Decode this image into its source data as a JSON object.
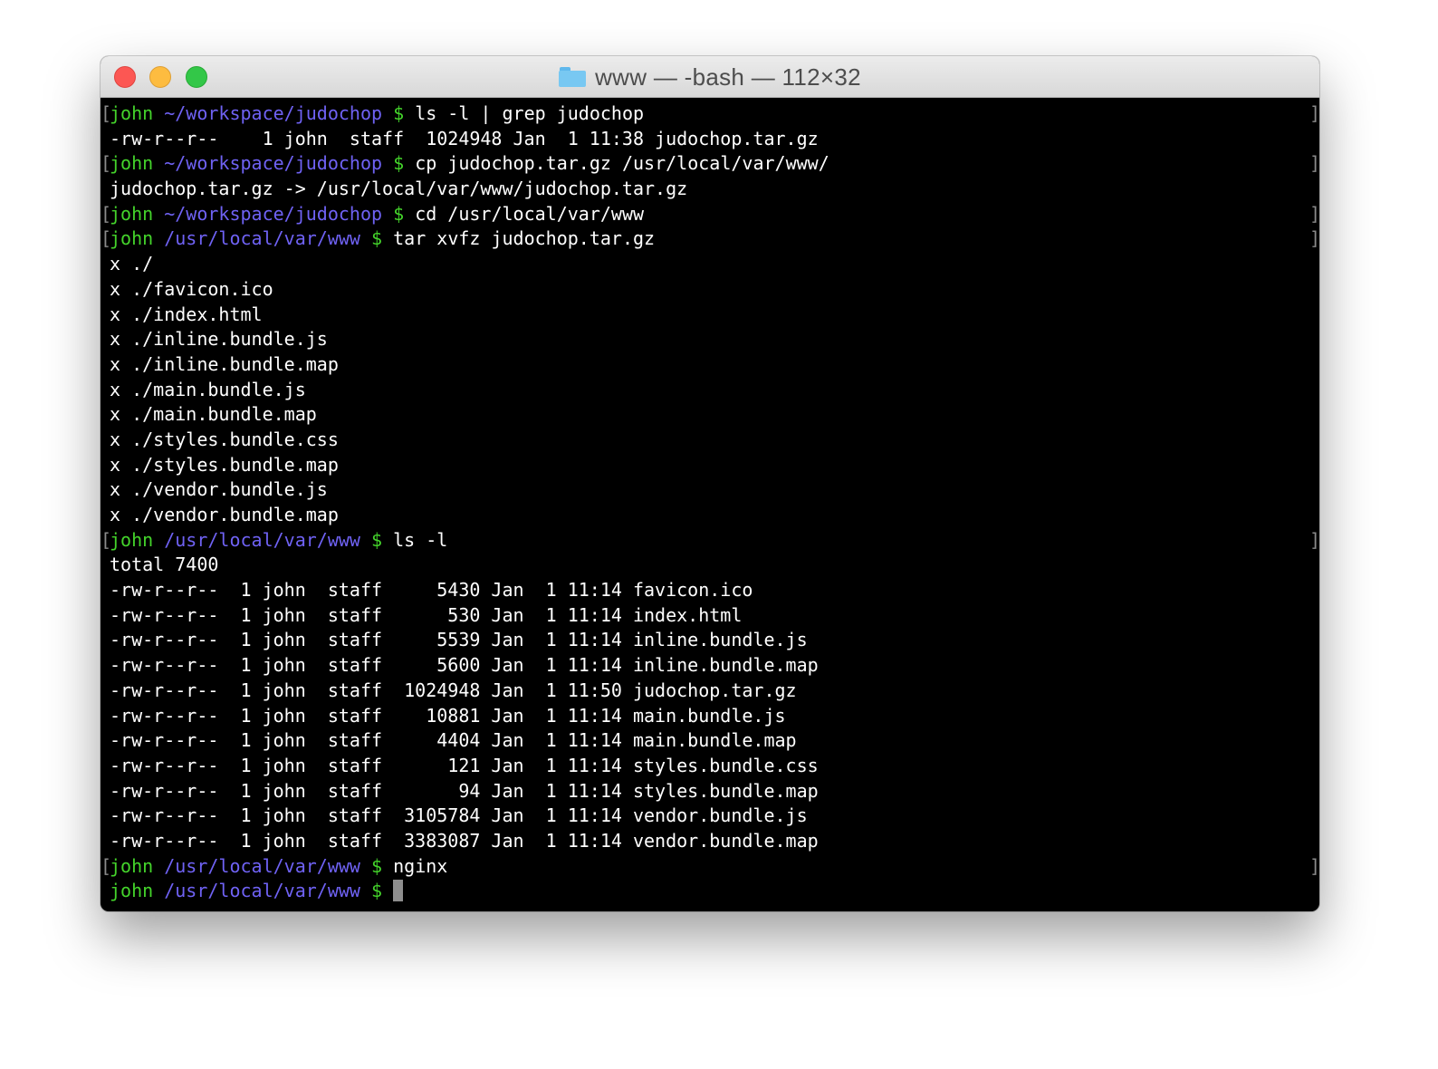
{
  "window": {
    "title": "www — -bash — 112×32"
  },
  "terminal": {
    "lines": [
      {
        "type": "prompt",
        "user": "john",
        "path": "~/workspace/judochop",
        "symbol": "$",
        "command": "ls -l | grep judochop"
      },
      {
        "type": "output",
        "text": "-rw-r--r--    1 john  staff  1024948 Jan  1 11:38 judochop.tar.gz"
      },
      {
        "type": "prompt",
        "user": "john",
        "path": "~/workspace/judochop",
        "symbol": "$",
        "command": "cp judochop.tar.gz /usr/local/var/www/"
      },
      {
        "type": "output",
        "text": "judochop.tar.gz -> /usr/local/var/www/judochop.tar.gz"
      },
      {
        "type": "prompt",
        "user": "john",
        "path": "~/workspace/judochop",
        "symbol": "$",
        "command": "cd /usr/local/var/www"
      },
      {
        "type": "prompt",
        "user": "john",
        "path": "/usr/local/var/www",
        "symbol": "$",
        "command": "tar xvfz judochop.tar.gz"
      },
      {
        "type": "output",
        "text": "x ./"
      },
      {
        "type": "output",
        "text": "x ./favicon.ico"
      },
      {
        "type": "output",
        "text": "x ./index.html"
      },
      {
        "type": "output",
        "text": "x ./inline.bundle.js"
      },
      {
        "type": "output",
        "text": "x ./inline.bundle.map"
      },
      {
        "type": "output",
        "text": "x ./main.bundle.js"
      },
      {
        "type": "output",
        "text": "x ./main.bundle.map"
      },
      {
        "type": "output",
        "text": "x ./styles.bundle.css"
      },
      {
        "type": "output",
        "text": "x ./styles.bundle.map"
      },
      {
        "type": "output",
        "text": "x ./vendor.bundle.js"
      },
      {
        "type": "output",
        "text": "x ./vendor.bundle.map"
      },
      {
        "type": "prompt",
        "user": "john",
        "path": "/usr/local/var/www",
        "symbol": "$",
        "command": "ls -l"
      },
      {
        "type": "output",
        "text": "total 7400"
      },
      {
        "type": "output",
        "text": "-rw-r--r--  1 john  staff     5430 Jan  1 11:14 favicon.ico"
      },
      {
        "type": "output",
        "text": "-rw-r--r--  1 john  staff      530 Jan  1 11:14 index.html"
      },
      {
        "type": "output",
        "text": "-rw-r--r--  1 john  staff     5539 Jan  1 11:14 inline.bundle.js"
      },
      {
        "type": "output",
        "text": "-rw-r--r--  1 john  staff     5600 Jan  1 11:14 inline.bundle.map"
      },
      {
        "type": "output",
        "text": "-rw-r--r--  1 john  staff  1024948 Jan  1 11:50 judochop.tar.gz"
      },
      {
        "type": "output",
        "text": "-rw-r--r--  1 john  staff    10881 Jan  1 11:14 main.bundle.js"
      },
      {
        "type": "output",
        "text": "-rw-r--r--  1 john  staff     4404 Jan  1 11:14 main.bundle.map"
      },
      {
        "type": "output",
        "text": "-rw-r--r--  1 john  staff      121 Jan  1 11:14 styles.bundle.css"
      },
      {
        "type": "output",
        "text": "-rw-r--r--  1 john  staff       94 Jan  1 11:14 styles.bundle.map"
      },
      {
        "type": "output",
        "text": "-rw-r--r--  1 john  staff  3105784 Jan  1 11:14 vendor.bundle.js"
      },
      {
        "type": "output",
        "text": "-rw-r--r--  1 john  staff  3383087 Jan  1 11:14 vendor.bundle.map"
      },
      {
        "type": "prompt",
        "user": "john",
        "path": "/usr/local/var/www",
        "symbol": "$",
        "command": "nginx"
      },
      {
        "type": "active",
        "user": "john",
        "path": "/usr/local/var/www",
        "symbol": "$",
        "command": ""
      }
    ]
  },
  "colors": {
    "prompt_user": "#44d42b",
    "prompt_path": "#6f62f4",
    "background": "#000000",
    "text": "#ffffff"
  },
  "icons": {
    "close": "close-icon",
    "minimize": "minimize-icon",
    "maximize": "maximize-icon",
    "folder": "folder-icon"
  }
}
